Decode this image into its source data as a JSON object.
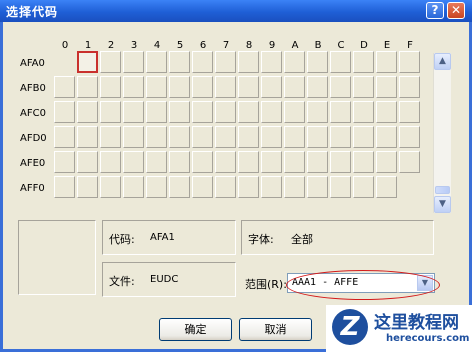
{
  "window": {
    "title": "选择代码",
    "help_glyph": "?",
    "close_glyph": "✕"
  },
  "grid": {
    "column_headers": [
      "0",
      "1",
      "2",
      "3",
      "4",
      "5",
      "6",
      "7",
      "8",
      "9",
      "A",
      "B",
      "C",
      "D",
      "E",
      "F"
    ],
    "row_labels": [
      "AFA0",
      "AFB0",
      "AFC0",
      "AFD0",
      "AFE0",
      "AFF0"
    ],
    "selected_code": "AFA1"
  },
  "scrollbar": {
    "up_glyph": "▲",
    "down_glyph": "▼"
  },
  "info": {
    "code_label": "代码:",
    "code_value": "AFA1",
    "font_label": "字体:",
    "font_value": "全部",
    "file_label": "文件:",
    "file_value": "EUDC",
    "range_label": "范围(R):",
    "range_value": "AAA1 - AFFE"
  },
  "buttons": {
    "ok": "确定",
    "cancel": "取消"
  },
  "watermark": {
    "logo": "Z",
    "title": "这里教程网",
    "url": "herecours.com"
  },
  "colors": {
    "titlebar": "#1f5fd6",
    "selection": "#c9302c",
    "annotation_ellipse": "#d31b1b"
  }
}
